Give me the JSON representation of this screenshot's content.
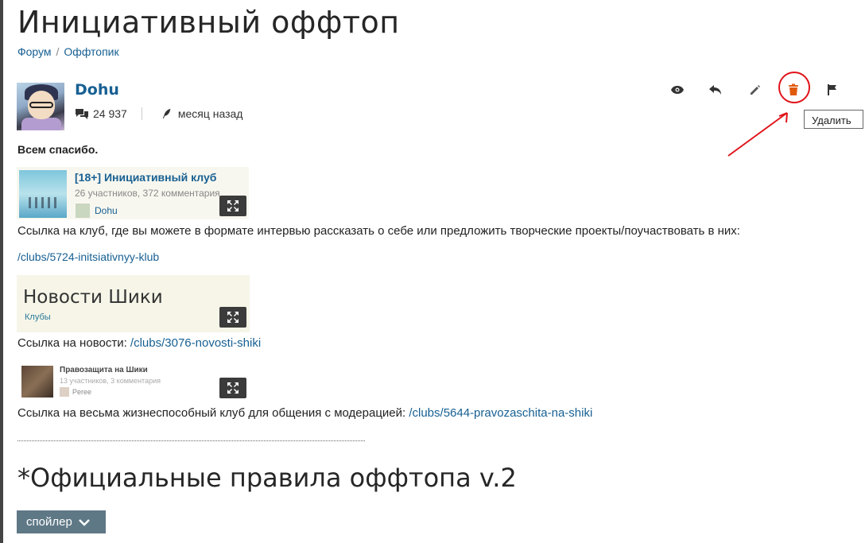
{
  "page": {
    "title": "Инициативный оффтоп",
    "breadcrumbs": [
      "Форум",
      "Оффтопик"
    ],
    "breadcrumb_sep": "/"
  },
  "post": {
    "author": "Dohu",
    "comment_count": "24 937",
    "time_ago": "месяц назад",
    "actions": [
      "eye-icon",
      "reply-icon",
      "edit-icon",
      "delete-icon",
      "flag-icon"
    ],
    "delete_tooltip": "Удалить",
    "annotation_color": "#e0141b",
    "delete_icon_color": "#e05a0c"
  },
  "content": {
    "thanks": "Всем спасибо.",
    "club1": {
      "title": "[18+] Инициативный клуб",
      "meta": "26 участников, 372 комментария",
      "author": "Dohu"
    },
    "club1_desc": "Ссылка на клуб, где вы можете в формате интервью рассказать о себе или предложить творческие проекты/поучаствовать в них:",
    "club1_link": "/clubs/5724-initsiativnyy-klub",
    "club2": {
      "title": "Новости Шики",
      "sub": "Клубы"
    },
    "club2_label": "Ссылка на новости: ",
    "club2_link": "/clubs/3076-novosti-shiki",
    "club3": {
      "title": "Правозащита на Шики",
      "meta": "13 участников, 3 комментария",
      "author": "Peree"
    },
    "club3_label": "Ссылка на весьма жизнеспособный клуб для общения с модерацией: ",
    "club3_link": "/clubs/5644-pravozaschita-na-shiki",
    "rules_heading": "*Официальные правила оффтопа v.2",
    "spoiler_label": "спойлер"
  },
  "colors": {
    "link": "#176093",
    "spoiler_bg": "#5f7886"
  }
}
